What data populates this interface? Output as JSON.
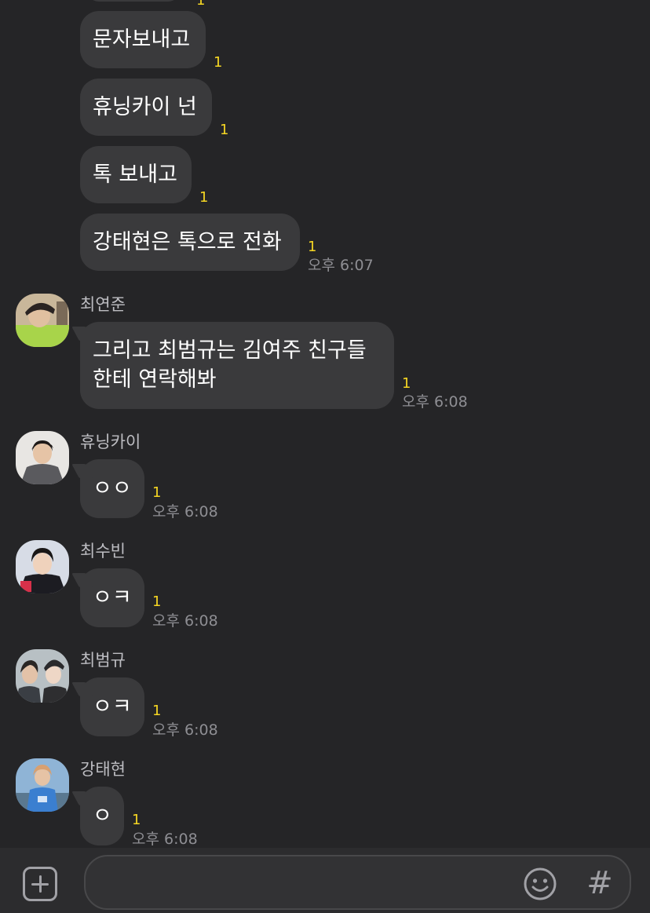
{
  "messages": [
    {
      "text": "문자보내고",
      "unread": "1"
    },
    {
      "text": "휴닝카이 넌",
      "unread": "1"
    },
    {
      "text": "톡 보내고",
      "unread": "1"
    },
    {
      "text": "강태현은 톡으로 전화",
      "unread": "1",
      "time": "오후 6:07"
    },
    {
      "sender": "최연준",
      "line1": "그리고 최범규는 김여주 친구들",
      "line2": "한테 연락해봐",
      "unread": "1",
      "time": "오후 6:08"
    },
    {
      "sender": "휴닝카이",
      "text": "ㅇㅇ",
      "unread": "1",
      "time": "오후 6:08"
    },
    {
      "sender": "최수빈",
      "text": "ㅇㅋ",
      "unread": "1",
      "time": "오후 6:08"
    },
    {
      "sender": "최범규",
      "text": "ㅇㅋ",
      "unread": "1",
      "time": "오후 6:08"
    },
    {
      "sender": "강태현",
      "text": "ㅇ",
      "unread": "1",
      "time": "오후 6:08"
    }
  ],
  "top_partial_unread": "1",
  "input": {
    "value": "",
    "placeholder": ""
  },
  "icons": {
    "plus": "plus-square-icon",
    "emoji": "smiley-icon",
    "hash": "#"
  },
  "colors": {
    "background": "#252527",
    "bubble": "#3a3a3c",
    "unread": "#f5d623",
    "time": "#8e8e93",
    "input_bar": "#2c2c2e"
  }
}
